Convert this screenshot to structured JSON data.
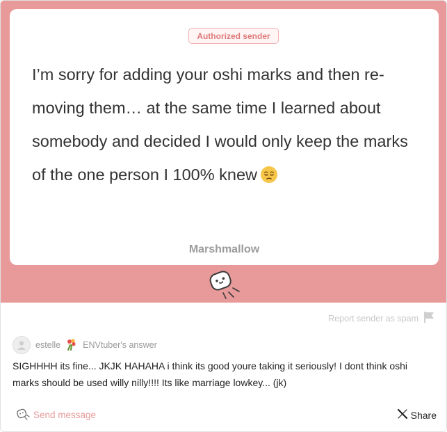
{
  "card": {
    "badge": "Authorized sender",
    "message": "I’m sorry for adding your oshi marks and then re-moving them… at the same time I learned about somebody and decided I would only keep the marks of the one person I 100% knew",
    "emoji": "pensive-face",
    "site_name": "Marshmallow"
  },
  "actions": {
    "report_label": "Report sender as spam",
    "send_label": "Send message",
    "share_label": "Share"
  },
  "answer": {
    "author": "estelle",
    "suffix": "ENVtuber's answer",
    "text": "SIGHHHH its fine... JKJK HAHAHA i think its good youre taking it seriously! I dont think oshi marks should be used willy nilly!!!! Its like marriage lowkey... (jk)"
  },
  "colors": {
    "accent_pink": "#e89999",
    "badge_text": "#df7a7a",
    "muted": "#999999"
  }
}
